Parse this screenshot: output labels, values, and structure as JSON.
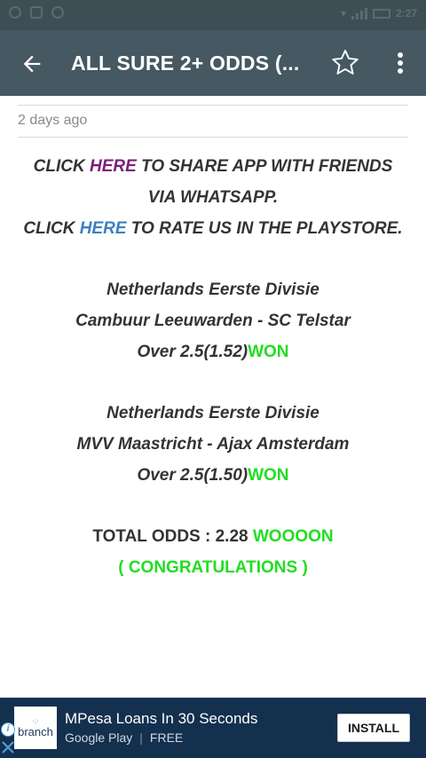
{
  "status_bar": {
    "right_text": "2:27"
  },
  "app_bar": {
    "title": "ALL SURE 2+ ODDS (...",
    "back_icon": "arrow-back-icon",
    "star_icon": "star-outline-icon",
    "menu_icon": "more-vert-icon"
  },
  "post": {
    "date": "2 days ago",
    "share_prefix": "CLICK ",
    "share_link": "HERE",
    "share_suffix": " TO SHARE APP WITH FRIENDS",
    "share_line2": "VIA WHATSAPP.",
    "rate_prefix": "CLICK ",
    "rate_link": "HERE",
    "rate_suffix": " TO RATE US IN THE PLAYSTORE.",
    "tips": [
      {
        "league": "Netherlands Eerste Divisie",
        "match": "Cambuur Leeuwarden - SC Telstar",
        "pick": "Over 2.5(1.52)",
        "result": "WON"
      },
      {
        "league": "Netherlands Eerste Divisie",
        "match": "MVV Maastricht - Ajax Amsterdam",
        "pick": "Over 2.5(1.50)",
        "result": "WON"
      }
    ],
    "total_label": "TOTAL ODDS : 2.28 ",
    "total_result": "WOOOON",
    "congrats": "( CONGRATULATIONS )"
  },
  "ad": {
    "logo_text": "branch",
    "title": "MPesa Loans In 30 Seconds",
    "store": "Google Play",
    "separator": "|",
    "price": "FREE",
    "install_label": "INSTALL",
    "info_icon": "info-icon",
    "close_icon": "close-icon"
  },
  "colors": {
    "app_bar": "#465861",
    "status_bar": "#3f4d54",
    "link_purple": "#7a1f7a",
    "link_blue": "#3d7fc1",
    "won_green": "#22dd22",
    "ad_bg": "#14304f"
  }
}
